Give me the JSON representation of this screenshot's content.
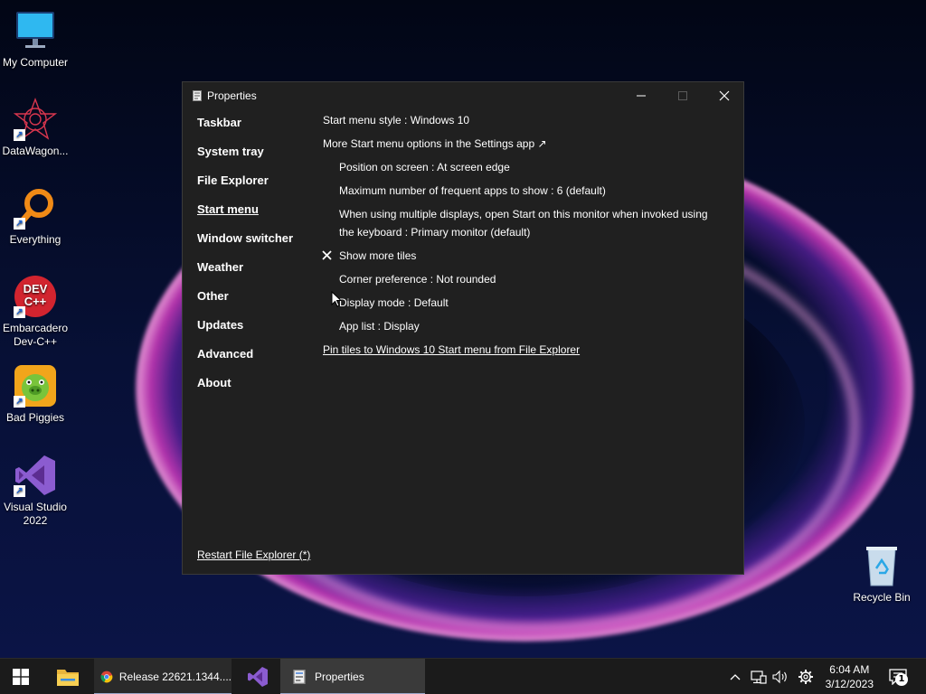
{
  "desktop": {
    "icons": [
      {
        "label": "My Computer",
        "icon": "monitor-icon"
      },
      {
        "label": "DataWagon...",
        "icon": "datawagon-icon"
      },
      {
        "label": "Everything",
        "icon": "magnifier-icon"
      },
      {
        "label": "Embarcadero Dev-C++",
        "icon": "devcpp-icon",
        "badge": "DEV C++"
      },
      {
        "label": "Bad Piggies",
        "icon": "bad-piggies-icon"
      },
      {
        "label": "Visual Studio 2022",
        "icon": "visual-studio-icon"
      },
      {
        "label": "Recycle Bin",
        "icon": "recycle-bin-icon"
      }
    ]
  },
  "window": {
    "title": "Properties",
    "nav": [
      "Taskbar",
      "System tray",
      "File Explorer",
      "Start menu",
      "Window switcher",
      "Weather",
      "Other",
      "Updates",
      "Advanced",
      "About"
    ],
    "active_nav": "Start menu",
    "settings": {
      "start_style": "Start menu style : Windows 10",
      "more_options": "More Start menu options in the Settings app ↗",
      "position": "Position on screen : At screen edge",
      "max_frequent": "Maximum number of frequent apps to show : 6 (default)",
      "multi_display": "When using multiple displays, open Start on this monitor when invoked using the keyboard : Primary monitor (default)",
      "show_more_tiles": "Show more tiles",
      "corner": "Corner preference : Not rounded",
      "display_mode": "Display mode : Default",
      "app_list": "App list : Display",
      "pin_tiles": "Pin tiles to Windows 10 Start menu from File Explorer"
    },
    "restart": "Restart File Explorer (*)"
  },
  "taskbar": {
    "apps": [
      {
        "label": "Release 22621.1344....",
        "icon": "chrome-icon"
      },
      {
        "label": "Properties",
        "icon": "properties-icon"
      }
    ],
    "time": "6:04 AM",
    "date": "3/12/2023",
    "notification_count": "1"
  }
}
